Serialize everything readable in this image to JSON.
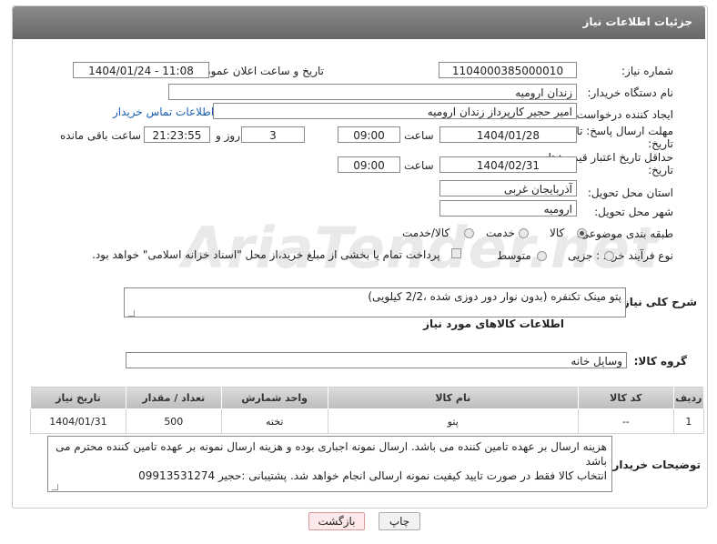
{
  "page": {
    "title": "جزئیات اطلاعات نیاز"
  },
  "form": {
    "need_number_label": "شماره نیاز:",
    "need_number": "1104000385000010",
    "announce_label": "تاریخ و ساعت اعلان عمومی:",
    "announce_value": "1404/01/24 - 11:08",
    "buyer_org_label": "نام دستگاه خریدار:",
    "buyer_org": "زندان ارومیه",
    "creator_label": "ایجاد کننده درخواست:",
    "creator": "امیر حجیر کارپرداز زندان ارومیه",
    "contact_link": "اطلاعات تماس خریدار",
    "reply_deadline_label": "مهلت ارسال پاسخ: تا تاریخ:",
    "reply_date": "1404/01/28",
    "time_label": "ساعت",
    "reply_time": "09:00",
    "days_value": "3",
    "days_label": "روز و",
    "remaining_value": "21:23:55",
    "remaining_label": "ساعت باقی مانده",
    "price_validity_label": "حداقل تاریخ اعتبار قیمت: تا تاریخ:",
    "price_date": "1404/02/31",
    "price_time": "09:00",
    "province_label": "استان محل تحویل:",
    "province": "آذربایجان غربی",
    "city_label": "شهر محل تحویل:",
    "city": "ارومیه",
    "category_label": "طبقه بندی موضوعی:",
    "category_options": [
      "کالا",
      "خدمت",
      "کالا/خدمت"
    ],
    "process_label": "نوع فرآیند خرید :",
    "process_options": [
      "جزیی",
      "متوسط"
    ],
    "payment_note": "پرداخت تمام یا بخشی از مبلغ خرید،از محل \"اسناد خزانه اسلامی\" خواهد بود."
  },
  "description": {
    "label": "شرح کلی نیاز:",
    "value": "پتو مینک تکنفره (بدون نوار دور دوزی شده ،2/2 کیلویی)"
  },
  "goods": {
    "section_title": "اطلاعات کالاهای مورد نیاز",
    "group_label": "گروه کالا:",
    "group_value": "وسایل خانه",
    "columns": [
      "ردیف",
      "کد کالا",
      "نام کالا",
      "واحد شمارش",
      "تعداد / مقدار",
      "تاریخ نیاز"
    ],
    "rows": [
      [
        "1",
        "--",
        "پتو",
        "تخته",
        "500",
        "1404/01/31"
      ]
    ]
  },
  "buyer_notes": {
    "label": "توضیحات خریدار:",
    "lines": [
      "هزینه ارسال بر عهده تامین کننده می باشد. ارسال نمونه اجباری بوده و هزینه ارسال نمونه بر عهده تامین کننده محترم می باشد",
      "انتخاب کالا فقط در صورت تایید کیفیت نمونه ارسالی انجام خواهد شد. پشتیبانی :حجیر 09913531274"
    ]
  },
  "buttons": {
    "print": "چاپ",
    "back": "بازگشت"
  },
  "watermark": "AriaTender.net"
}
